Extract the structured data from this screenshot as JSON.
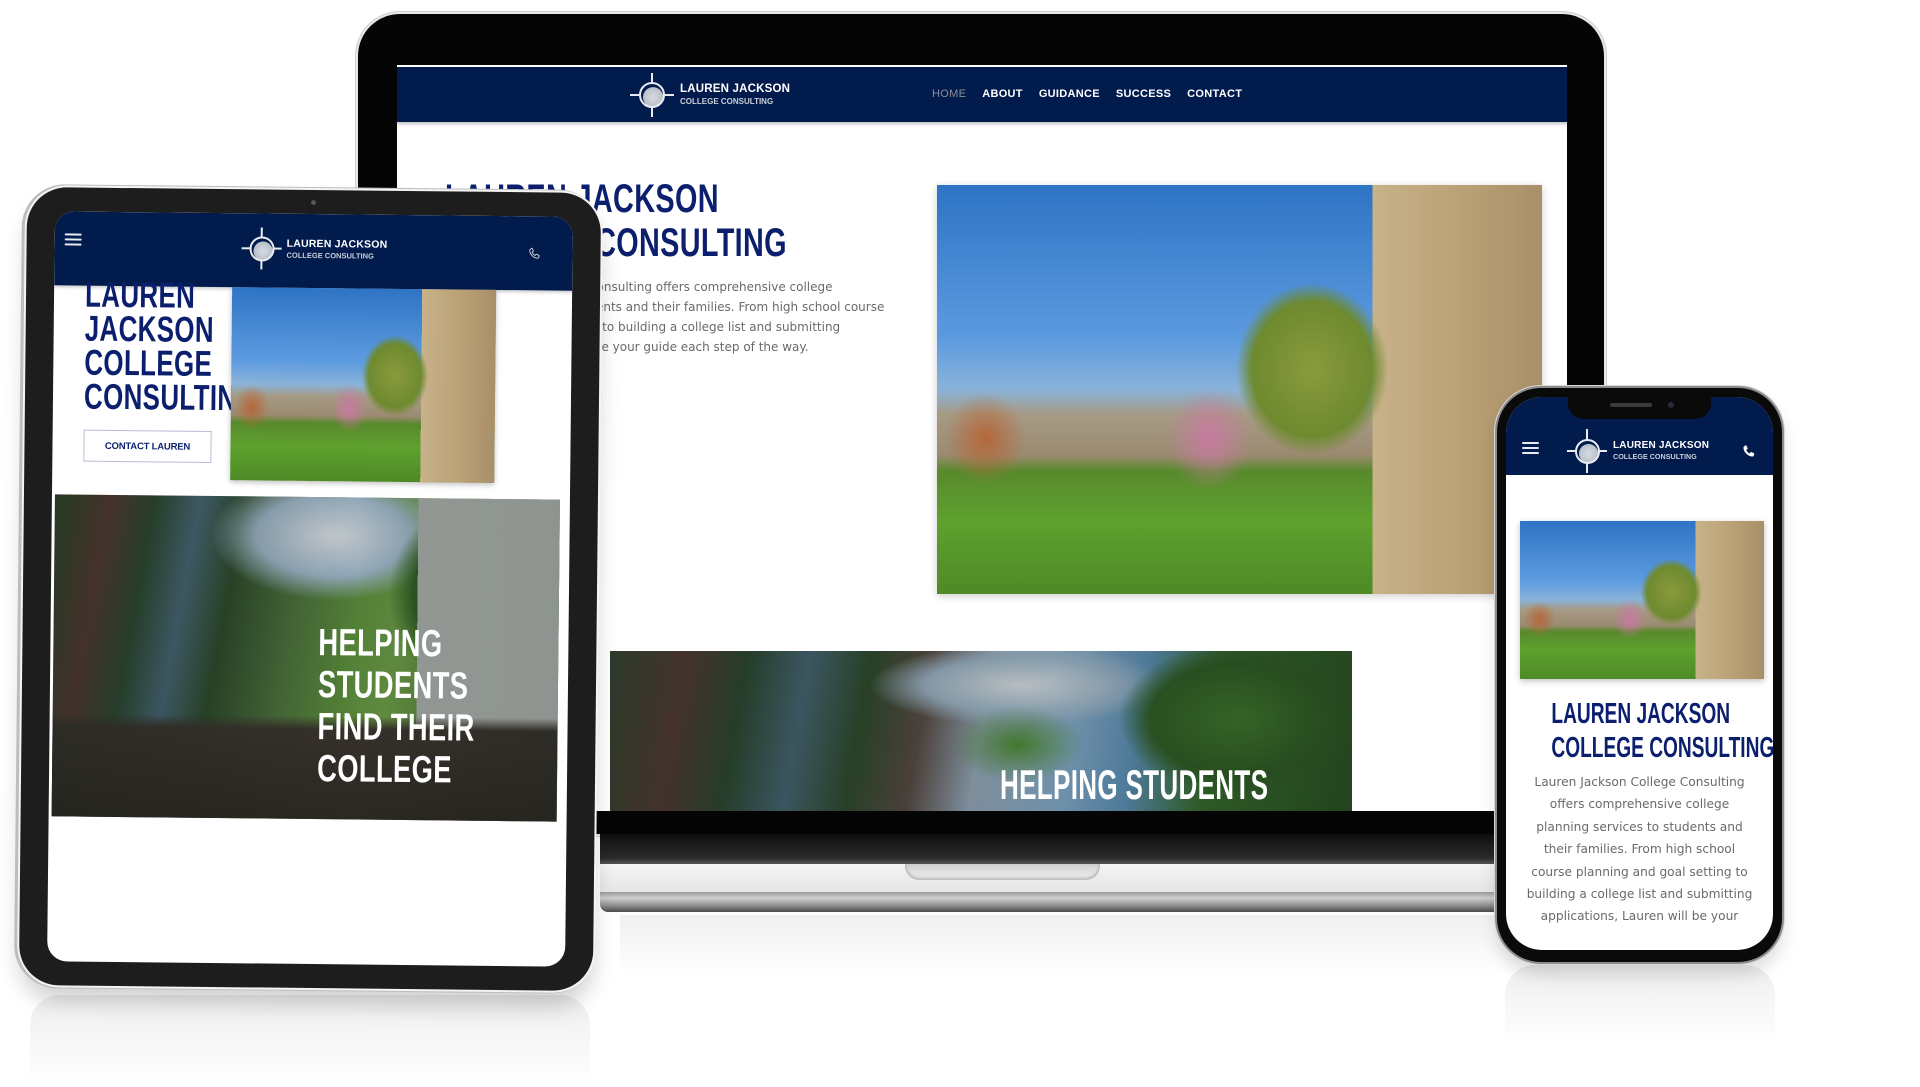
{
  "brand": {
    "name": "LAUREN JACKSON",
    "tagline": "COLLEGE CONSULTING",
    "colors": {
      "navy": "#021b4d",
      "heading": "#0b1f6e",
      "body_text": "#6a6a6a",
      "nav_active": "#8c8f99"
    }
  },
  "laptop": {
    "nav": [
      {
        "label": "HOME",
        "active": true
      },
      {
        "label": "ABOUT",
        "active": false
      },
      {
        "label": "GUIDANCE",
        "active": false
      },
      {
        "label": "SUCCESS",
        "active": false
      },
      {
        "label": "CONTACT",
        "active": false
      }
    ],
    "hero": {
      "heading_line1": "LAUREN JACKSON",
      "heading_line2": "COLLEGE CONSULTING",
      "paragraph_lines": [
        "Lauren Jackson College Consulting offers comprehensive college",
        "planning services to students and their families. From high school course",
        "planning and goal setting to building a college list and submitting",
        "applications, Lauren will be your guide each step of the way."
      ],
      "image_alt": "campus-quad-photo"
    },
    "banner": {
      "text": "HELPING STUDENTS",
      "image_alt": "ivy-building-photo"
    }
  },
  "tablet": {
    "menu_icon": "hamburger-icon",
    "call_icon": "phone-icon",
    "hero": {
      "heading_lines": [
        "LAUREN",
        "JACKSON",
        "COLLEGE",
        "CONSULTING"
      ],
      "cta_label": "CONTACT LAUREN",
      "image_alt": "campus-quad-photo"
    },
    "banner": {
      "text_lines": [
        "HELPING",
        "STUDENTS",
        "FIND THEIR",
        "COLLEGE"
      ],
      "image_alt": "ivy-building-photo"
    }
  },
  "phone": {
    "menu_icon": "hamburger-icon",
    "call_icon": "phone-icon",
    "hero": {
      "image_alt": "campus-quad-photo",
      "heading_line1": "LAUREN JACKSON",
      "heading_line2": "COLLEGE CONSULTING",
      "paragraph_lines": [
        "Lauren Jackson College Consulting",
        "offers comprehensive college",
        "planning services to students and",
        "their families. From high school",
        "course planning and goal setting to",
        "building a college list and submitting",
        "applications, Lauren will be your"
      ]
    }
  }
}
